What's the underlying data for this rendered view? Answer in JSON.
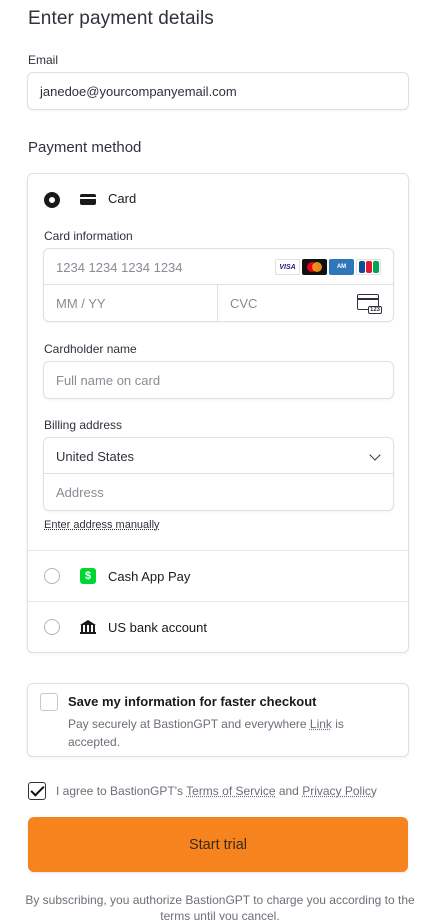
{
  "header": {
    "title": "Enter payment details"
  },
  "email": {
    "label": "Email",
    "value": "janedoe@yourcompanyemail.com"
  },
  "payment_method": {
    "heading": "Payment method",
    "card": {
      "label": "Card",
      "selected": true,
      "card_information_label": "Card information",
      "card_number_placeholder": "1234 1234 1234 1234",
      "brands": [
        "VISA",
        "Mastercard",
        "Amex",
        "JCB"
      ],
      "expiry_placeholder": "MM / YY",
      "cvc_placeholder": "CVC",
      "cvc_icon_text": "123",
      "cardholder_label": "Cardholder name",
      "cardholder_placeholder": "Full name on card",
      "billing_label": "Billing address",
      "country_value": "United States",
      "address_placeholder": "Address",
      "manual_link": "Enter address manually"
    },
    "cash_app": {
      "label": "Cash App Pay",
      "icon_text": "$",
      "selected": false
    },
    "bank": {
      "label": "US bank account",
      "selected": false
    }
  },
  "save_info": {
    "title": "Save my information for faster checkout",
    "desc_before": "Pay securely at BastionGPT and everywhere ",
    "desc_link": "Link",
    "desc_after": " is accepted.",
    "checked": false
  },
  "agree": {
    "checked": true,
    "text_before": "I agree to BastionGPT's ",
    "terms": "Terms of Service",
    "and": " and ",
    "privacy": "Privacy Policy"
  },
  "cta": {
    "label": "Start trial",
    "color": "#f6831d"
  },
  "footer": {
    "text": "By subscribing, you authorize BastionGPT to charge you according to the terms until you cancel."
  }
}
